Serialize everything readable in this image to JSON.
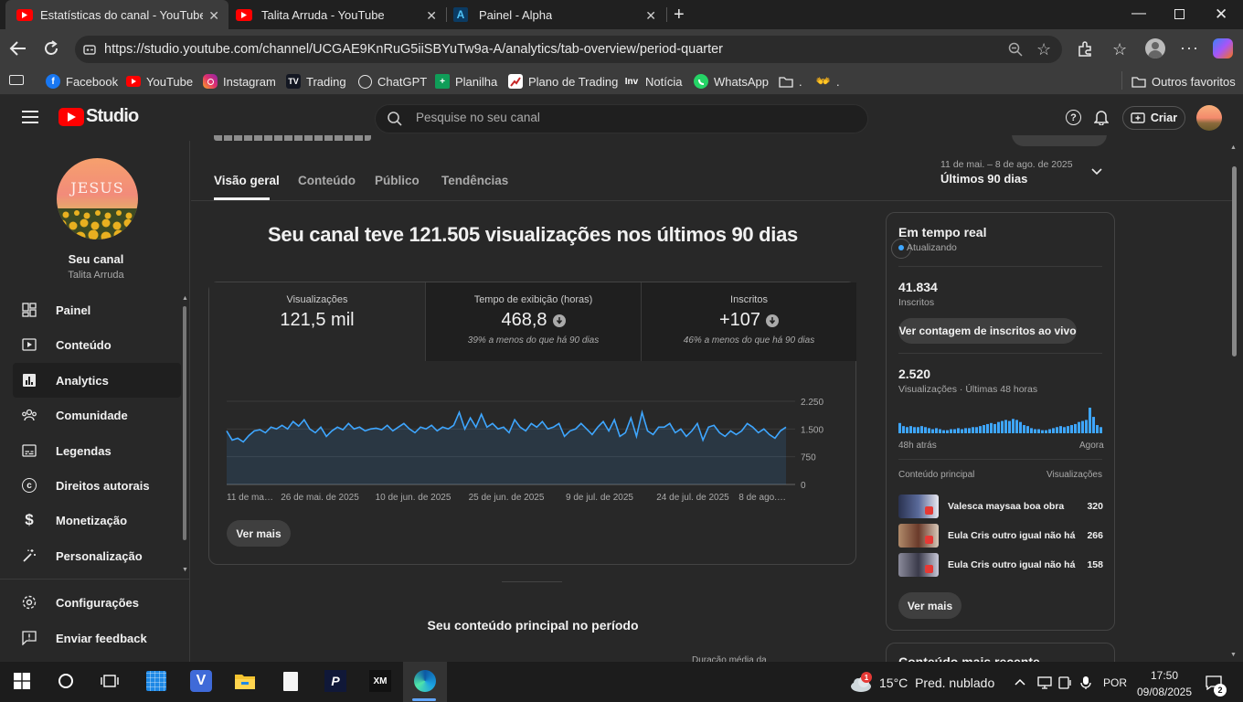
{
  "browser": {
    "tabs": [
      {
        "title": "Estatísticas do canal - YouTube Studio"
      },
      {
        "title": "Talita Arruda - YouTube"
      },
      {
        "title": "Painel - Alpha"
      }
    ],
    "url": "https://studio.youtube.com/channel/UCGAE9KnRuG5iiSBYuTw9a-A/analytics/tab-overview/period-quarter",
    "bookmarks": [
      {
        "label": "Facebook",
        "icon": "facebook-icon",
        "color": "#1877f2"
      },
      {
        "label": "YouTube",
        "icon": "youtube-icon",
        "color": "#ff0000"
      },
      {
        "label": "Instagram",
        "icon": "instagram-icon",
        "color": "#e1306c"
      },
      {
        "label": "Trading",
        "icon": "tradingview-icon",
        "color": "#131722"
      },
      {
        "label": "ChatGPT",
        "icon": "chatgpt-icon",
        "color": "#444444"
      },
      {
        "label": "Planilha",
        "icon": "sheets-icon",
        "color": "#0f9d58"
      },
      {
        "label": "Plano de Trading",
        "icon": "chart-icon",
        "color": "#c62828"
      },
      {
        "label": "Notícia",
        "icon": "investing-icon",
        "color": "#333333"
      },
      {
        "label": "WhatsApp",
        "icon": "whatsapp-icon",
        "color": "#25d366"
      },
      {
        "label": ".",
        "icon": "folder-icon",
        "color": "#3c3c3c"
      },
      {
        "label": ".",
        "icon": "hands-icon",
        "color": "#3c3c3c"
      }
    ],
    "other_bookmarks": "Outros favoritos"
  },
  "header": {
    "logo_text": "Studio",
    "search_placeholder": "Pesquise no seu canal",
    "create_label": "Criar"
  },
  "sidebar": {
    "channel_avatar_text": "JESUS",
    "channel_label": "Seu canal",
    "channel_name": "Talita Arruda",
    "items": [
      {
        "label": "Painel",
        "icon": "dashboard-icon"
      },
      {
        "label": "Conteúdo",
        "icon": "content-icon"
      },
      {
        "label": "Analytics",
        "icon": "analytics-icon",
        "active": true
      },
      {
        "label": "Comunidade",
        "icon": "community-icon"
      },
      {
        "label": "Legendas",
        "icon": "subtitles-icon"
      },
      {
        "label": "Direitos autorais",
        "icon": "copyright-icon"
      },
      {
        "label": "Monetização",
        "icon": "monetization-icon"
      },
      {
        "label": "Personalização",
        "icon": "customization-icon"
      },
      {
        "label": "Configurações",
        "icon": "settings-icon"
      },
      {
        "label": "Enviar feedback",
        "icon": "feedback-icon"
      }
    ]
  },
  "analytics": {
    "tabs": [
      "Visão geral",
      "Conteúdo",
      "Público",
      "Tendências"
    ],
    "period_range": "11 de mai. – 8 de ago. de 2025",
    "period_label": "Últimos 90 dias",
    "headline": "Seu canal teve 121.505 visualizações nos últimos 90 dias",
    "metrics": [
      {
        "label": "Visualizações",
        "value": "121,5 mil",
        "comparison": ""
      },
      {
        "label": "Tempo de exibição (horas)",
        "value": "468,8",
        "comparison": "39% a menos do que há 90 dias",
        "trend": "down"
      },
      {
        "label": "Inscritos",
        "value": "+107",
        "comparison": "46% a menos do que há 90 dias",
        "trend": "down"
      }
    ],
    "see_more": "Ver mais",
    "section_title": "Seu conteúdo principal no período",
    "section_column": "Duração média da"
  },
  "chart_data": {
    "type": "area",
    "series": [
      {
        "values": [
          1450,
          1200,
          1250,
          1150,
          1320,
          1450,
          1480,
          1400,
          1550,
          1500,
          1600,
          1500,
          1700,
          1580,
          1750,
          1500,
          1400,
          1550,
          1300,
          1450,
          1550,
          1480,
          1650,
          1500,
          1550,
          1450,
          1500,
          1520,
          1480,
          1600,
          1450,
          1550,
          1650,
          1500,
          1400,
          1550,
          1500,
          1600,
          1450,
          1550,
          1500,
          1600,
          1950,
          1500,
          1800,
          1550,
          1900,
          1550,
          1650,
          1500,
          1550,
          1400,
          1750,
          1550,
          1450,
          1650,
          1550,
          1700,
          1500,
          1550,
          1650,
          1300,
          1450,
          1500,
          1650,
          1500,
          1350,
          1550,
          1700,
          1450,
          1750,
          1300,
          1400,
          1800,
          1300,
          1950,
          1450,
          1350,
          1550,
          1550,
          1650,
          1400,
          1500,
          1300,
          1450,
          1650,
          1200,
          1550,
          1600,
          1400,
          1300,
          1450,
          1350,
          1450,
          1650,
          1550,
          1400,
          1500,
          1350,
          1250,
          1450,
          1550
        ]
      }
    ],
    "x_tick_labels": [
      "11 de ma…",
      "26 de mai. de 2025",
      "10 de jun. de 2025",
      "25 de jun. de 2025",
      "9 de jul. de 2025",
      "24 de jul. de 2025",
      "8 de ago.…"
    ],
    "y_ticks": [
      0,
      750,
      1500,
      2250
    ],
    "y_tick_labels": [
      "0",
      "750",
      "1.500",
      "2.250"
    ],
    "ylim": [
      0,
      2250
    ],
    "grid": true,
    "color": "#3ea6ff"
  },
  "realtime": {
    "title": "Em tempo real",
    "status": "Atualizando",
    "subscribers": "41.834",
    "subscribers_label": "Inscritos",
    "live_button": "Ver contagem de inscritos ao vivo",
    "views": "2.520",
    "views_label": "Visualizações · Últimas 48 horas",
    "ago_label": "48h atrás",
    "now_label": "Agora",
    "col_content": "Conteúdo principal",
    "col_views": "Visualizações",
    "bars": [
      10,
      7,
      6,
      7,
      6,
      6,
      7,
      6,
      5,
      4,
      5,
      4,
      3,
      3,
      4,
      4,
      5,
      4,
      5,
      5,
      6,
      6,
      7,
      8,
      9,
      10,
      9,
      11,
      12,
      13,
      12,
      14,
      13,
      11,
      8,
      7,
      5,
      4,
      4,
      3,
      3,
      4,
      5,
      6,
      7,
      6,
      7,
      8,
      9,
      11,
      12,
      13,
      25,
      16,
      8,
      6
    ],
    "videos": [
      {
        "title": "Valesca maysaa boa obra",
        "views": "320"
      },
      {
        "title": "Eula Cris outro igual não há",
        "views": "266"
      },
      {
        "title": "Eula Cris outro igual não há",
        "views": "158"
      }
    ],
    "see_more": "Ver mais",
    "next_card_title": "Conteúdo mais recente"
  },
  "taskbar": {
    "weather_temp": "15°C",
    "weather_desc": "Pred. nublado",
    "weather_badge": "1",
    "language": "POR",
    "time": "17:50",
    "date": "09/08/2025",
    "notif_count": "2"
  }
}
